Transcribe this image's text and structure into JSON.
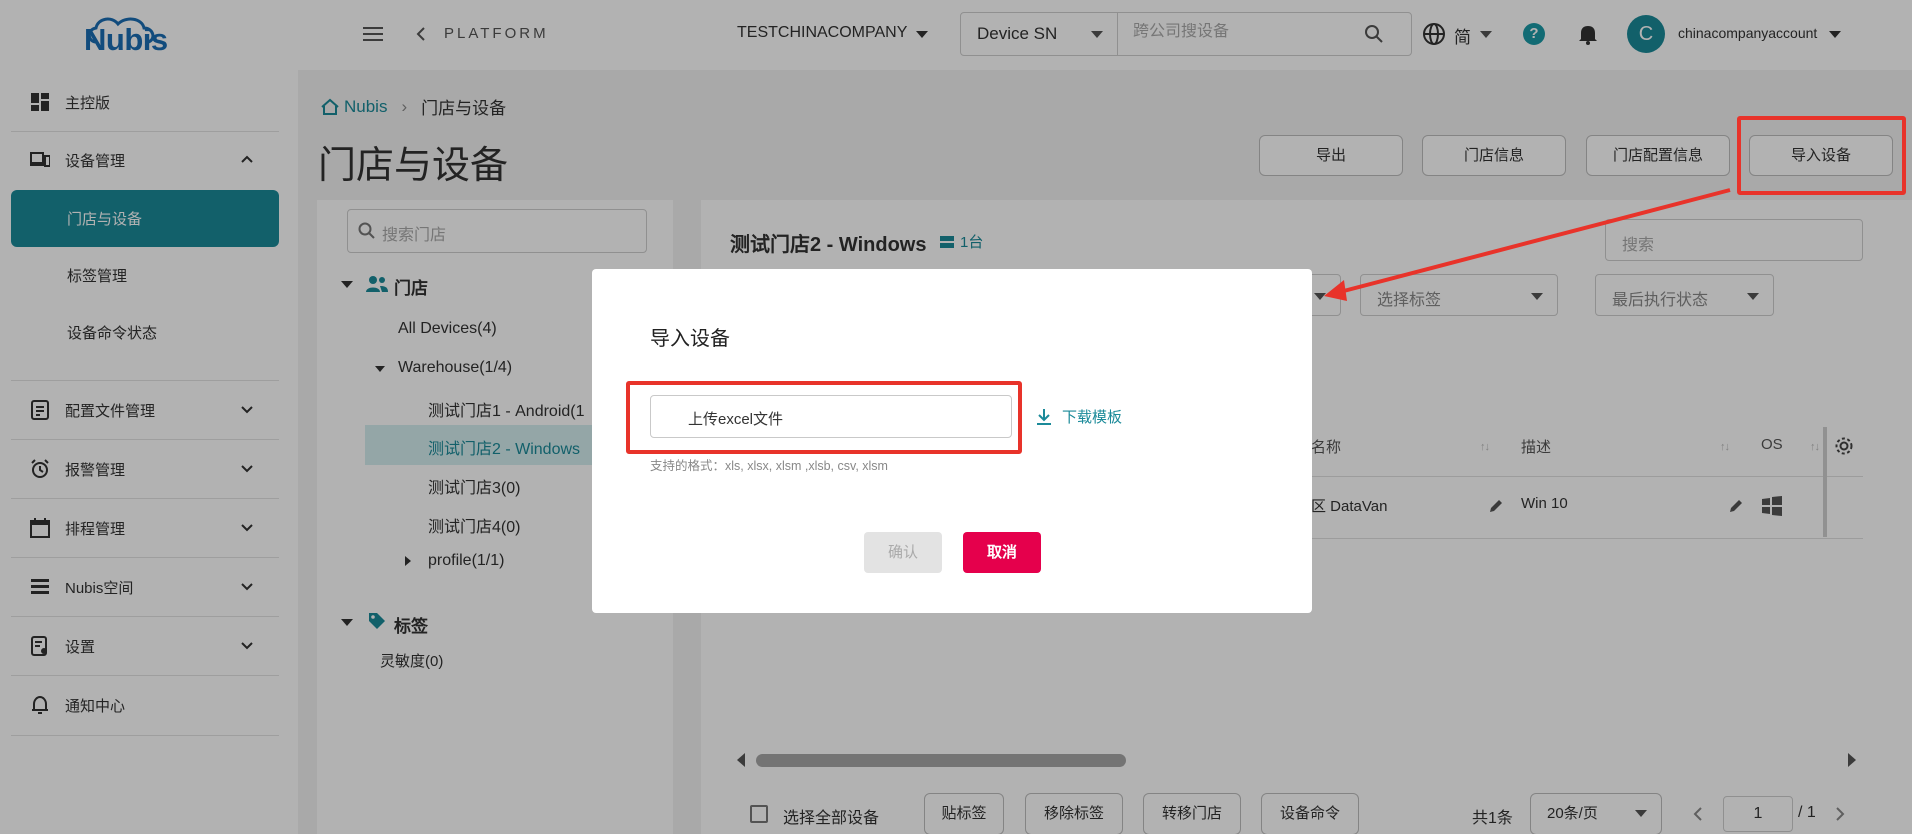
{
  "logo": {
    "text": "Nubis"
  },
  "sidebar": {
    "items": [
      {
        "label": "主控版"
      },
      {
        "label": "设备管理"
      },
      {
        "label": "门店与设备"
      },
      {
        "label": "标签管理"
      },
      {
        "label": "设备命令状态"
      },
      {
        "label": "配置文件管理"
      },
      {
        "label": "报警管理"
      },
      {
        "label": "排程管理"
      },
      {
        "label": "Nubis空间"
      },
      {
        "label": "设置"
      },
      {
        "label": "通知中心"
      }
    ]
  },
  "topbar": {
    "platform": "PLATFORM",
    "company": "TESTCHINACOMPANY",
    "search_type": "Device SN",
    "search_placeholder": "跨公司搜设备",
    "lang": "简",
    "help": "?",
    "avatar_letter": "C",
    "account": "chinacompanyaccount"
  },
  "breadcrumb": {
    "root": "Nubis",
    "current": "门店与设备"
  },
  "page": {
    "title": "门店与设备",
    "buttons": {
      "export": "导出",
      "store_info": "门店信息",
      "store_config": "门店配置信息",
      "import": "导入设备"
    }
  },
  "tree": {
    "search_placeholder": "搜索门店",
    "stores_header": "门店",
    "all_devices": "All Devices(4)",
    "warehouse": "Warehouse(1/4)",
    "store1": "测试门店1 - Android(1",
    "store2": "测试门店2 - Windows",
    "store3": "测试门店3(0)",
    "store4": "测试门店4(0)",
    "profile": "profile(1/1)",
    "tags_header": "标签",
    "tag1": "灵敏度(0)"
  },
  "detail": {
    "store_name": "测试门店2 - Windows",
    "device_count": "1台",
    "search_placeholder": "搜索",
    "filter_tags": "选择标签",
    "filter_last_status": "最后执行状态",
    "table": {
      "headers": [
        "名称",
        "描述",
        "OS"
      ],
      "row": {
        "name": "区 DataVan",
        "desc": "Win 10"
      }
    }
  },
  "bottom": {
    "select_all": "选择全部设备",
    "btn_tag": "贴标签",
    "btn_remove_tag": "移除标签",
    "btn_move_store": "转移门店",
    "btn_command": "设备命令",
    "total": "共1条",
    "per_page": "20条/页",
    "page": "1",
    "total_pages": "/ 1"
  },
  "modal": {
    "title": "导入设备",
    "upload_label": "上传excel文件",
    "download_template": "下载模板",
    "formats": "支持的格式：xls, xlsx, xlsm ,xlsb, csv, xlsm",
    "confirm": "确认",
    "cancel": "取消"
  },
  "colors": {
    "accent": "#1b8a99",
    "danger": "#e5004c",
    "annotation": "#e8332a"
  }
}
